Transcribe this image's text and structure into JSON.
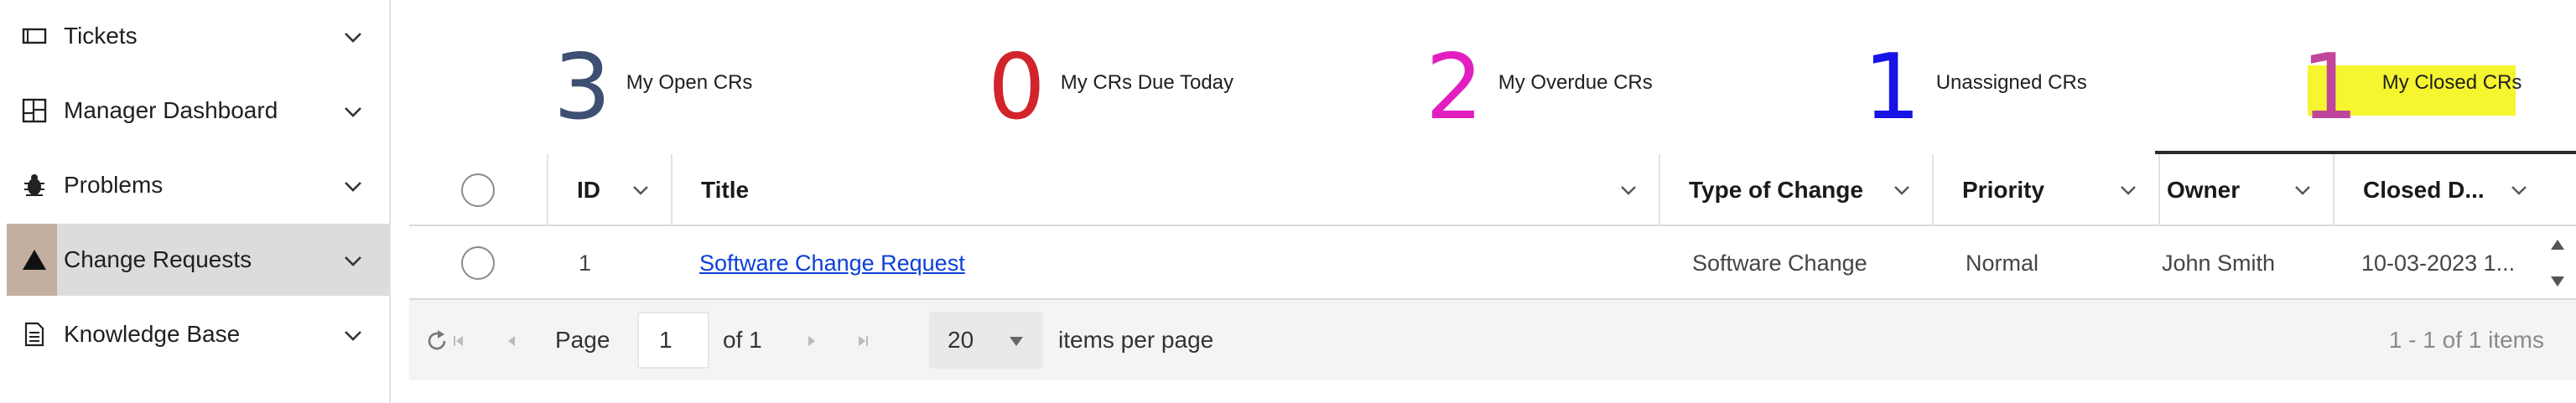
{
  "sidebar": {
    "items": [
      {
        "label": "Tickets",
        "icon": "ticket-icon",
        "active": false
      },
      {
        "label": "Manager Dashboard",
        "icon": "dashboard-icon",
        "active": false
      },
      {
        "label": "Problems",
        "icon": "bug-icon",
        "active": false
      },
      {
        "label": "Change Requests",
        "icon": "triangle-icon",
        "active": true
      },
      {
        "label": "Knowledge Base",
        "icon": "document-icon",
        "active": false
      }
    ]
  },
  "summary": {
    "cards": [
      {
        "value": "3",
        "label": "My Open CRs",
        "color": "#3d4f73"
      },
      {
        "value": "0",
        "label": "My CRs Due Today",
        "color": "#d1242b"
      },
      {
        "value": "2",
        "label": "My Overdue CRs",
        "color": "#e21ec0"
      },
      {
        "value": "1",
        "label": "Unassigned CRs",
        "color": "#1713e6"
      },
      {
        "value": "1",
        "label": "My Closed CRs",
        "color": "#c0459c",
        "highlight": "#f5f530"
      }
    ]
  },
  "grid": {
    "columns": [
      {
        "label": "ID"
      },
      {
        "label": "Title"
      },
      {
        "label": "Type of Change"
      },
      {
        "label": "Priority"
      },
      {
        "label": "Owner"
      },
      {
        "label": "Closed D..."
      }
    ],
    "rows": [
      {
        "id": "1",
        "title": "Software Change Request",
        "type": "Software Change",
        "priority": "Normal",
        "owner": "John Smith",
        "closed": "10-03-2023 1..."
      }
    ]
  },
  "pager": {
    "page_label": "Page",
    "page_value": "1",
    "of_label": "of 1",
    "page_size": "20",
    "items_per_page_label": "items per page",
    "summary": "1 - 1 of 1 items"
  }
}
